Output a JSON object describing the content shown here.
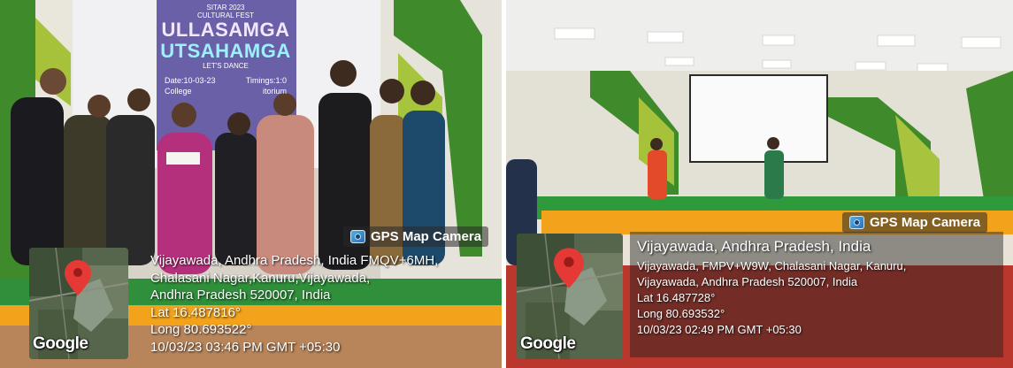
{
  "photos": [
    {
      "scene": "award presentation",
      "poster": {
        "line1": "SITAR 2023",
        "line2": "CULTURAL FEST",
        "title1": "ULLASAMGA",
        "title2": "UTSAHAMGA",
        "tagline": "LET'S DANCE",
        "date": "Date:10-03-23",
        "timings": "Timings:1:0",
        "venue": "College",
        "venue2": "itorium"
      },
      "badge": "GPS Map Camera",
      "map_label": "Google",
      "address_lines": [
        "Vijayawada, Andhra Pradesh, India FMQV+6MH,",
        "Chalasani Nagar,Kanuru,Vijayawada,",
        "Andhra Pradesh 520007, India"
      ],
      "lat": "Lat 16.487816°",
      "long": "Long 80.693522°",
      "datetime": "10/03/23 03:46 PM GMT +05:30"
    },
    {
      "scene": "dance performance on stage",
      "badge": "GPS Map Camera",
      "map_label": "Google",
      "address_title": "Vijayawada, Andhra Pradesh, India",
      "address_lines": [
        "Vijayawada, FMPV+W9W, Chalasani Nagar, Kanuru,",
        "Vijayawada, Andhra Pradesh 520007, India"
      ],
      "lat": "Lat 16.487728°",
      "long": "Long 80.693532°",
      "datetime": "10/03/23 02:49 PM GMT +05:30"
    }
  ],
  "colors": {
    "wall_green": "#3f8a2a",
    "pin_red": "#e53935",
    "stage_green": "#2f8f3a",
    "marigold": "#f2a21b"
  },
  "icons": [
    "camera-icon",
    "map-pin-icon"
  ]
}
